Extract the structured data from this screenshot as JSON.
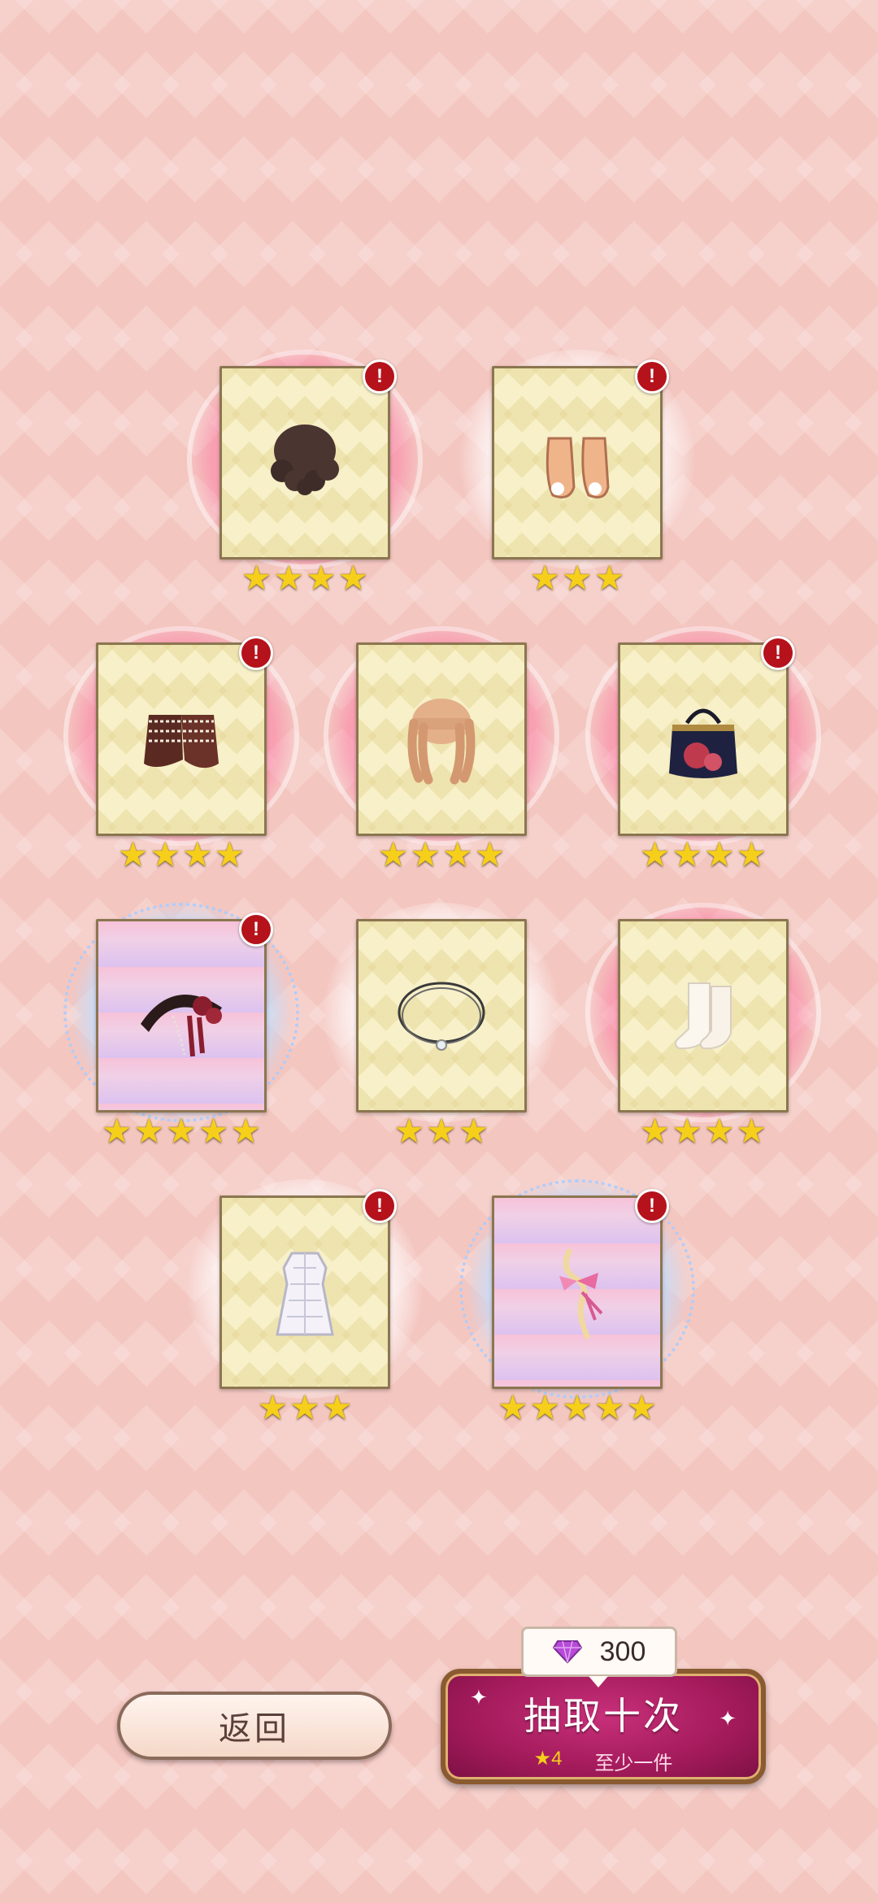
{
  "items": [
    {
      "name": "brown-curly-hair",
      "stars": 4,
      "halo": "pink",
      "badge": true
    },
    {
      "name": "peach-shoes",
      "stars": 3,
      "halo": "white",
      "badge": true
    },
    {
      "name": "brown-lace-shoes",
      "stars": 4,
      "halo": "pink",
      "badge": true
    },
    {
      "name": "blonde-curly-hair",
      "stars": 4,
      "halo": "pink",
      "badge": false
    },
    {
      "name": "rose-handbag",
      "stars": 4,
      "halo": "pink",
      "badge": true
    },
    {
      "name": "rose-headdress",
      "stars": 5,
      "halo": "blue",
      "badge": true
    },
    {
      "name": "pendant-necklace",
      "stars": 3,
      "halo": "white",
      "badge": false
    },
    {
      "name": "white-socks",
      "stars": 4,
      "halo": "pink",
      "badge": false
    },
    {
      "name": "white-dress",
      "stars": 3,
      "halo": "white",
      "badge": true
    },
    {
      "name": "ribbon-wand",
      "stars": 5,
      "halo": "blue",
      "badge": true
    }
  ],
  "badge_text": "!",
  "back_button": {
    "label": "返回"
  },
  "draw": {
    "cost": "300",
    "title": "抽取十次",
    "star_text": "★4",
    "guarantee_text": "至少一件"
  },
  "colors": {
    "background": "#f4c6c0",
    "badge": "#b5121b",
    "star": "#f5cf1a",
    "draw_button": "#a21a5a"
  }
}
